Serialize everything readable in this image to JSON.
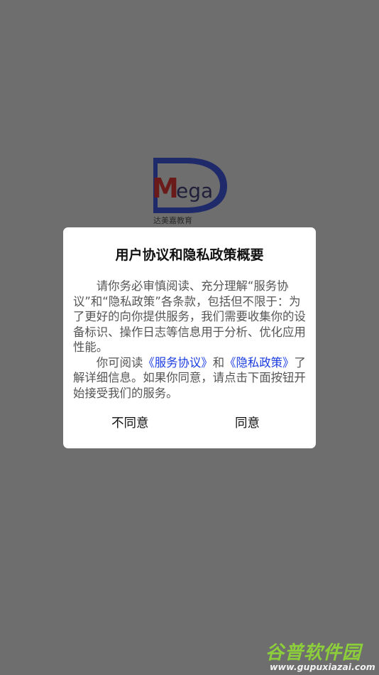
{
  "background": {
    "logo": {
      "text": "Mega",
      "caption": "达美嘉教育"
    }
  },
  "dialog": {
    "title": "用户协议和隐私政策概要",
    "paragraph1": "请你务必审慎阅读、充分理解“服务协议”和“隐私政策”各条款，包括但不限于：为了更好的向你提供服务，我们需要收集你的设备标识、操作日志等信息用于分析、优化应用性能。",
    "paragraph2_prefix": "你可阅读",
    "service_link": "《服务协议》",
    "and_text": "和",
    "privacy_link": "《隐私政策》",
    "paragraph2_suffix": "了解详细信息。如果你同意，请点击下面按钮开始接受我们的服务。",
    "disagree_label": "不同意",
    "agree_label": "同意"
  },
  "watermark": {
    "title": "谷普软件园",
    "url": "www.gupuxiazai.com"
  },
  "colors": {
    "overlay": "#6e6e6e",
    "link": "#1a3ce0",
    "watermark_green": "#8ccf3a"
  }
}
